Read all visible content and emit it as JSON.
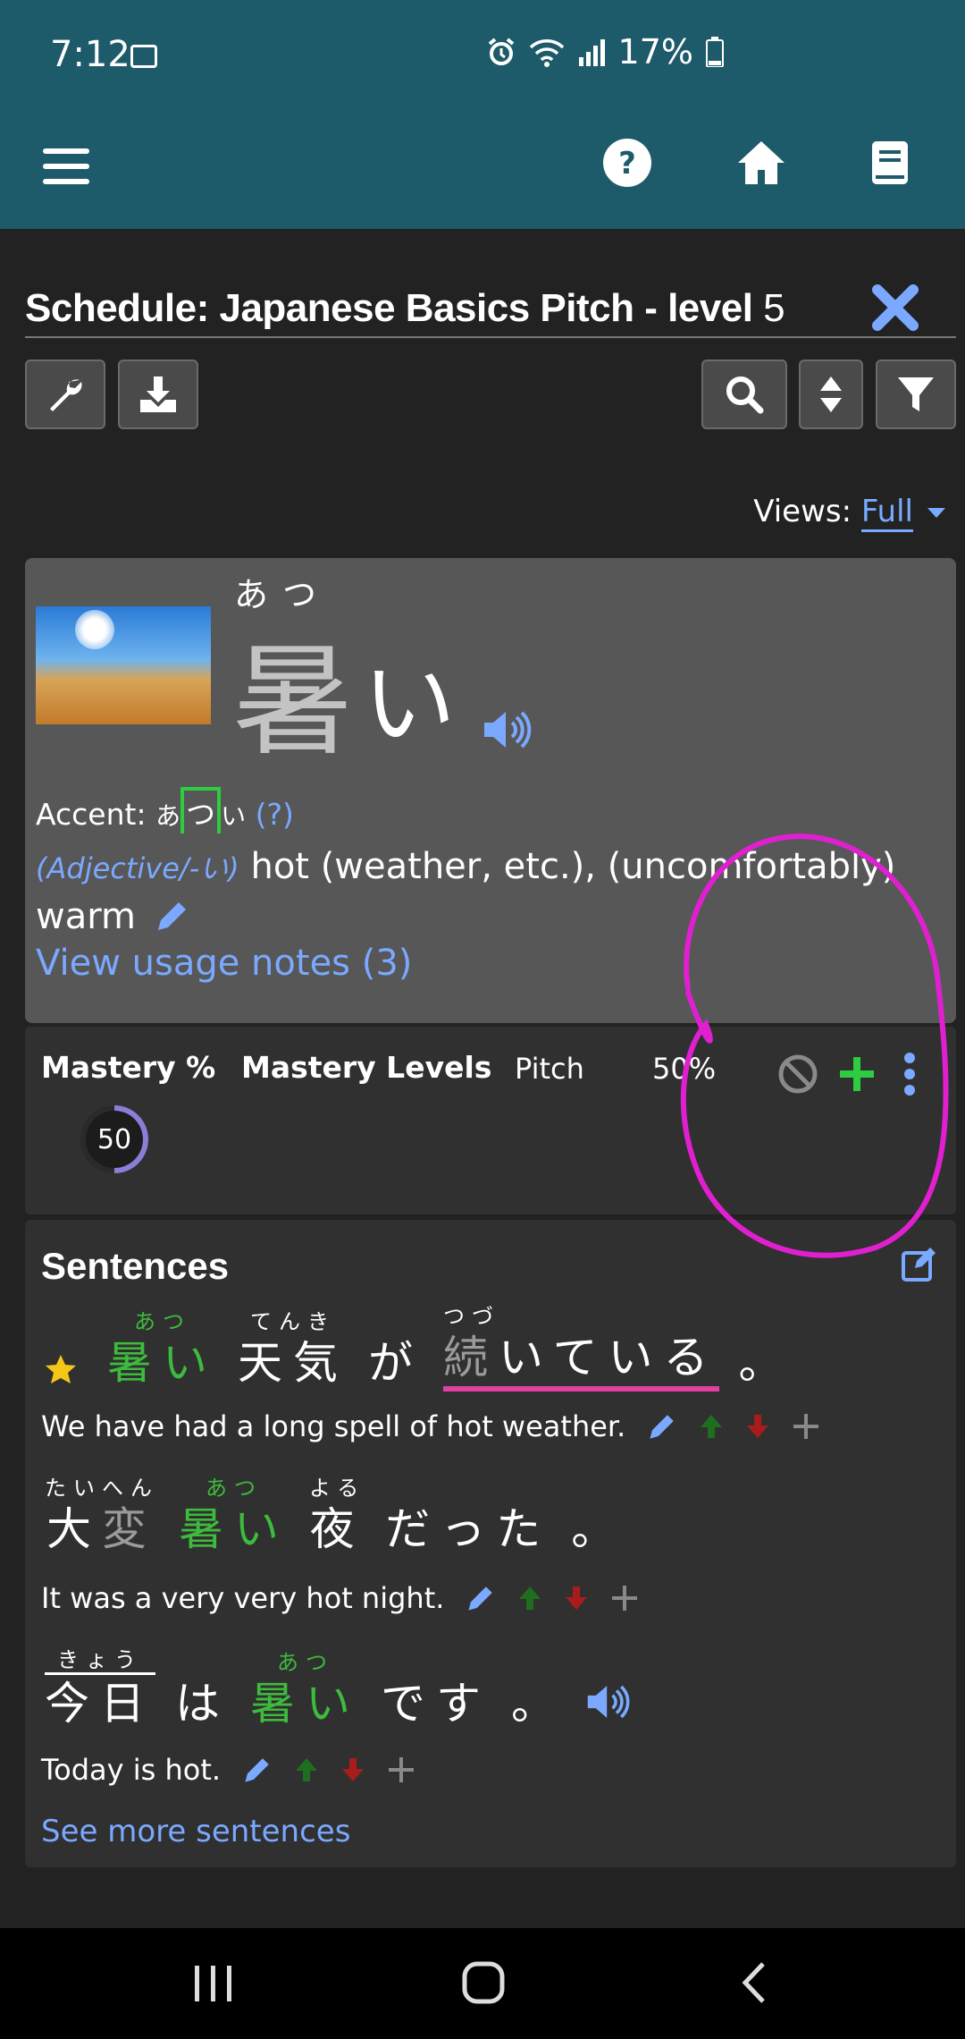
{
  "status_bar": {
    "time": "7:12",
    "battery": "17%"
  },
  "header": {
    "title": "Schedule: Japanese Basics Pitch - level",
    "level": "5"
  },
  "views": {
    "label": "Views:",
    "value": "Full"
  },
  "vocab": {
    "reading": "あつ",
    "kanji": "暑",
    "kana": "い",
    "accent_label": "Accent:",
    "accent_before": "あ",
    "accent_high": "つ",
    "accent_after": "い",
    "accent_help": "(?)",
    "pos": "(Adjective/-い)",
    "definition": "hot (weather, etc.), (uncomfortably) warm",
    "usage_link": "View usage notes (3)"
  },
  "mastery": {
    "h1": "Mastery %",
    "h2": "Mastery Levels",
    "pitch": "Pitch",
    "pitch_pct": "50%",
    "ring_value": "50",
    "ring_fraction": 0.5
  },
  "sentences": {
    "title": "Sentences",
    "s1": {
      "t1_r": "あつ",
      "t1_b": "暑い",
      "t2_r": "てんき",
      "t2_b": "天気",
      "t3_b": "が",
      "t4_r": "つづ",
      "t4_k": "続",
      "t4_b": "いている",
      "t5_b": "。",
      "en": "We have had a long spell of hot weather."
    },
    "s2": {
      "t1_r": "たいへん",
      "t1_a": "大",
      "t1_b": "変",
      "t2_r": "あつ",
      "t2_b": "暑い",
      "t3_r": "よる",
      "t3_b": "夜",
      "t4_b": "だった",
      "t5_b": "。",
      "en": "It was a very very hot night."
    },
    "s3": {
      "t1_r": "きょう",
      "t1_b": "今日",
      "t2_b": "は",
      "t3_r": "あつ",
      "t3_b": "暑い",
      "t4_b": "です",
      "t5_b": "。",
      "en": "Today is hot."
    },
    "more": "See more sentences"
  },
  "colors": {
    "appbar": "#1d5a6a",
    "accent_link": "#7aa9ff",
    "green": "#3dbb3d",
    "annotation": "#e020d0"
  },
  "icons": [
    "menu-icon",
    "help-icon",
    "home-icon",
    "book-icon",
    "close-icon",
    "wrench-icon",
    "download-icon",
    "search-icon",
    "sort-icon",
    "filter-icon",
    "speaker-icon",
    "pencil-icon",
    "ban-icon",
    "plus-icon",
    "more-vert-icon",
    "edit-box-icon",
    "star-icon",
    "arrow-up-icon",
    "arrow-down-icon",
    "recents-icon",
    "home-nav-icon",
    "back-icon"
  ]
}
